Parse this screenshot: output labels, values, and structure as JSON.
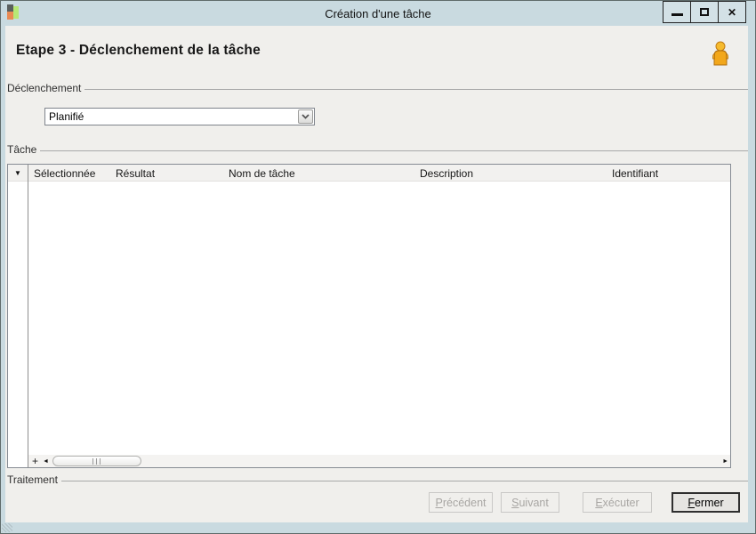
{
  "window": {
    "title": "Création d'une tâche",
    "controls": {
      "minimize": "─",
      "maximize": "□",
      "close": "✕"
    }
  },
  "header": {
    "title": "Etape 3 - Déclenchement de la tâche",
    "user_icon": "person-icon"
  },
  "trigger_group": {
    "label": "Déclenchement",
    "combo": {
      "value": "Planifié",
      "chevron_icon": "chevron-down"
    }
  },
  "task_group": {
    "label": "Tâche",
    "table": {
      "selector_icon": "▼",
      "columns": [
        "Sélectionnée",
        "Résultat",
        "Nom de tâche",
        "Description",
        "Identifiant"
      ],
      "rows": [],
      "scrollbar": {
        "add": "+",
        "left": "◄",
        "right": "►"
      }
    }
  },
  "processing_group": {
    "label": "Traitement"
  },
  "footer": {
    "buttons": [
      {
        "label": "Précédent",
        "enabled": false
      },
      {
        "label": "Suivant",
        "enabled": false
      },
      {
        "label": "Exécuter",
        "enabled": false
      },
      {
        "label": "Fermer",
        "enabled": true
      }
    ]
  },
  "colors": {
    "chrome": "#c9dae0",
    "body_bg": "#f0efec",
    "user_icon_fill": "#f2a71b",
    "app_icon": [
      "#5a5f5e",
      "#e98a53",
      "#b7e876"
    ]
  }
}
